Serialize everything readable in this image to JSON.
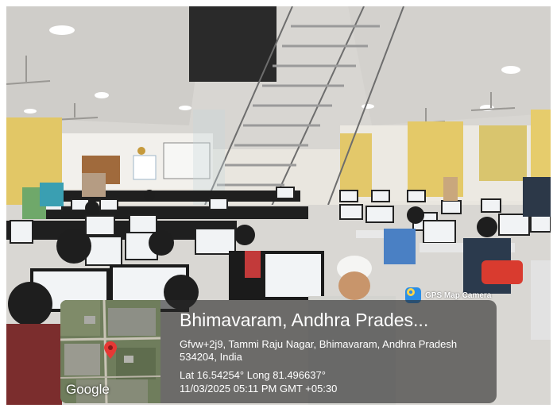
{
  "badge": {
    "label": "GPS Map Camera",
    "icon": "camera-icon"
  },
  "location": {
    "place": "Bhimavaram, Andhra Prades...",
    "address": "Gfvw+2j9, Tammi Raju Nagar, Bhimavaram, Andhra Pradesh 534204, India",
    "coordinates": "Lat 16.54254° Long 81.496637°",
    "datetime": "11/03/2025 05:11 PM GMT +05:30"
  },
  "map": {
    "provider_logo": "Google",
    "pin_color": "#e53935"
  }
}
